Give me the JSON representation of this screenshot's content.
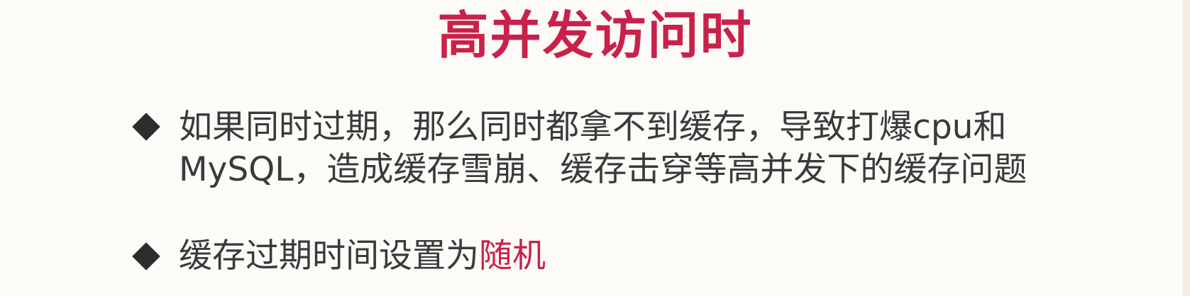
{
  "title": "高并发访问时",
  "bullets": [
    {
      "line1": "如果同时过期，那么同时都拿不到缓存，导致打爆cpu和",
      "line2": "MySQL，造成缓存雪崩、缓存击穿等高并发下的缓存问题"
    },
    {
      "text": "缓存过期时间设置为",
      "highlight": "随机"
    }
  ],
  "colors": {
    "accent": "#c9224a",
    "text": "#3a3a3a",
    "background": "#fdfbf8"
  },
  "icons": {
    "bullet": "diamond-bullet-icon"
  }
}
